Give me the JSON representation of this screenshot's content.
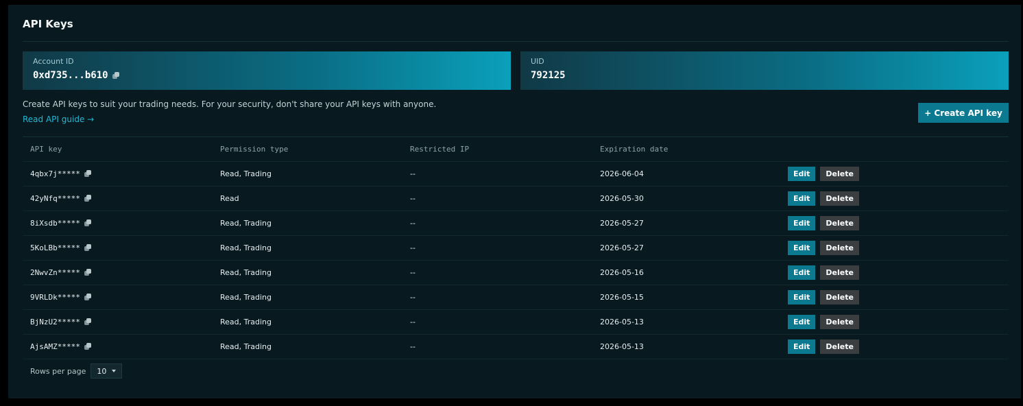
{
  "header": {
    "title": "API Keys"
  },
  "account_card": {
    "label": "Account ID",
    "value": "0xd735...b610"
  },
  "uid_card": {
    "label": "UID",
    "value": "792125"
  },
  "intro": {
    "description": "Create API keys to suit your trading needs. For your security, don't share your API keys with anyone.",
    "guide_link": "Read API guide →"
  },
  "create_button": {
    "label": "+ Create API key"
  },
  "table": {
    "columns": [
      "API key",
      "Permission type",
      "Restricted IP",
      "Expiration date"
    ],
    "rows": [
      {
        "key": "4qbx7j*****",
        "permission": "Read, Trading",
        "ip": "--",
        "expiration": "2026-06-04"
      },
      {
        "key": "42yNfq*****",
        "permission": "Read",
        "ip": "--",
        "expiration": "2026-05-30"
      },
      {
        "key": "8iXsdb*****",
        "permission": "Read, Trading",
        "ip": "--",
        "expiration": "2026-05-27"
      },
      {
        "key": "5KoLBb*****",
        "permission": "Read, Trading",
        "ip": "--",
        "expiration": "2026-05-27"
      },
      {
        "key": "2NwvZn*****",
        "permission": "Read, Trading",
        "ip": "--",
        "expiration": "2026-05-16"
      },
      {
        "key": "9VRLDk*****",
        "permission": "Read, Trading",
        "ip": "--",
        "expiration": "2026-05-15"
      },
      {
        "key": "BjNzU2*****",
        "permission": "Read, Trading",
        "ip": "--",
        "expiration": "2026-05-13"
      },
      {
        "key": "AjsAMZ*****",
        "permission": "Read, Trading",
        "ip": "--",
        "expiration": "2026-05-13"
      }
    ],
    "edit_label": "Edit",
    "delete_label": "Delete"
  },
  "pagination": {
    "rows_per_page_label": "Rows per page",
    "rows_per_page_value": "10"
  },
  "icons": {
    "copy": "copy-icon",
    "dropdown": "chevron-down-icon"
  },
  "colors": {
    "accent": "#0b7a91",
    "link": "#24b8d6",
    "background": "#081a1f"
  }
}
